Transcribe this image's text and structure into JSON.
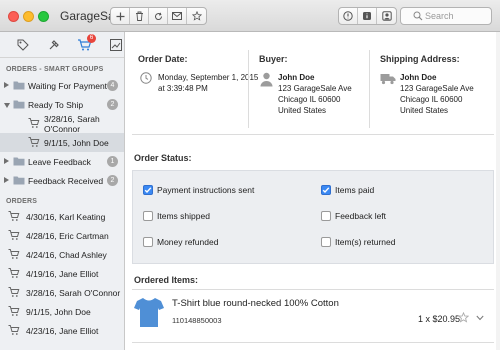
{
  "app": {
    "title": "GarageSale"
  },
  "toolbar": {
    "search_placeholder": "Search"
  },
  "sidebar": {
    "cart_badge": "6",
    "smart_groups_header": "ORDERS - SMART GROUPS",
    "groups": [
      {
        "label": "Waiting For Payment",
        "count": "4"
      },
      {
        "label": "Ready To Ship",
        "count": "2"
      },
      {
        "label": "3/28/16, Sarah O'Connor"
      },
      {
        "label": "9/1/15, John Doe"
      },
      {
        "label": "Leave Feedback",
        "count": "1"
      },
      {
        "label": "Feedback Received",
        "count": "2"
      }
    ],
    "orders_header": "ORDERS",
    "orders": [
      "4/30/16, Karl Keating",
      "4/28/16, Eric Cartman",
      "4/24/16, Chad Ashley",
      "4/19/16, Jane Elliot",
      "3/28/16, Sarah O'Connor",
      "9/1/15, John Doe",
      "4/23/16, Jane Elliot"
    ]
  },
  "order": {
    "date_label": "Order Date:",
    "date_line1": "Monday, September 1, 2015",
    "date_line2": "at 3:39:48 PM",
    "buyer_label": "Buyer:",
    "buyer_name": "John Doe",
    "buyer_street": "123 GarageSale Ave",
    "buyer_city": "Chicago IL 60600",
    "buyer_country": "United States",
    "ship_label": "Shipping Address:",
    "ship_name": "John Doe",
    "ship_street": "123 GarageSale Ave",
    "ship_city": "Chicago IL 60600",
    "ship_country": "United States"
  },
  "status": {
    "title": "Order Status:",
    "items": [
      {
        "label": "Payment instructions sent",
        "checked": true
      },
      {
        "label": "Items paid",
        "checked": true
      },
      {
        "label": "Items shipped",
        "checked": false
      },
      {
        "label": "Feedback left",
        "checked": false
      },
      {
        "label": "Money refunded",
        "checked": false
      },
      {
        "label": "Item(s) returned",
        "checked": false
      }
    ]
  },
  "ordered_items": {
    "title": "Ordered Items:",
    "item_title": "T-Shirt blue round-necked 100% Cotton",
    "item_number": "110148850003",
    "quantity_price": "1 x $20.95"
  },
  "colors": {
    "accent": "#3b89f3",
    "badge": "#e8453c",
    "shirt": "#4f8fd6"
  }
}
